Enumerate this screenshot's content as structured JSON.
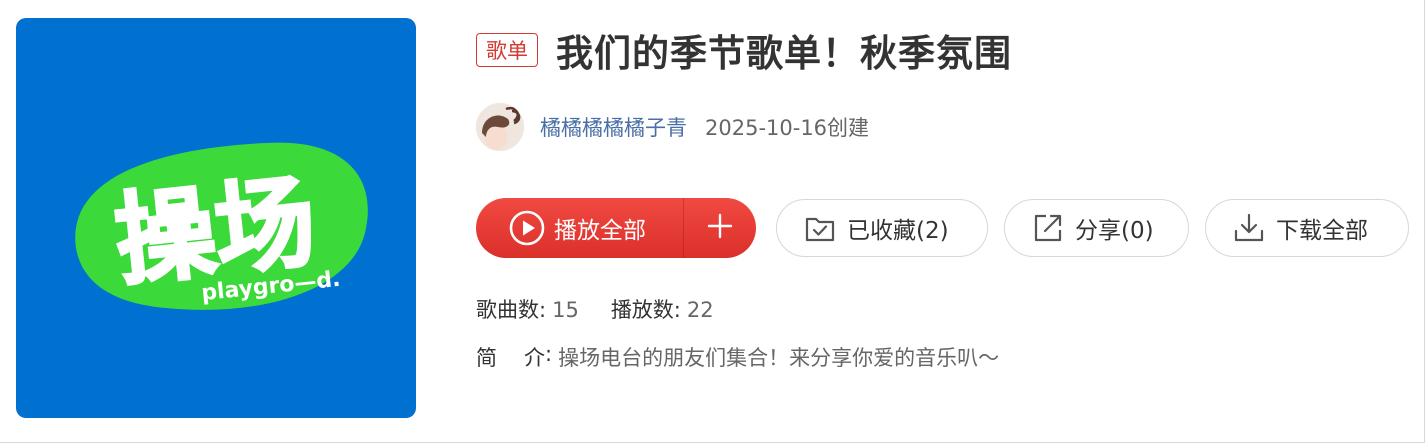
{
  "cover": {
    "logo_cn": "操场",
    "logo_en": "playgro—d.",
    "bg_color": "#0071d1",
    "blob_color": "#3cd93a"
  },
  "playlist": {
    "tag": "歌单",
    "title": "我们的季节歌单！秋季氛围",
    "creator": "橘橘橘橘橘子青",
    "created": "2025-10-16创建"
  },
  "buttons": {
    "play_all": "播放全部",
    "collect": "已收藏(2)",
    "share": "分享(0)",
    "download": "下载全部"
  },
  "stats": {
    "songs_label": "歌曲数:",
    "songs_value": "15",
    "plays_label": "播放数:",
    "plays_value": "22"
  },
  "description": {
    "label": "简介",
    "colon": ":",
    "text": "操场电台的朋友们集合！来分享你爱的音乐叭～"
  },
  "colors": {
    "accent_red": "#e63a33",
    "link_blue": "#4a6fa5"
  },
  "icons": [
    "play-circle-icon",
    "plus-icon",
    "folder-check-icon",
    "share-arrow-icon",
    "download-icon"
  ]
}
